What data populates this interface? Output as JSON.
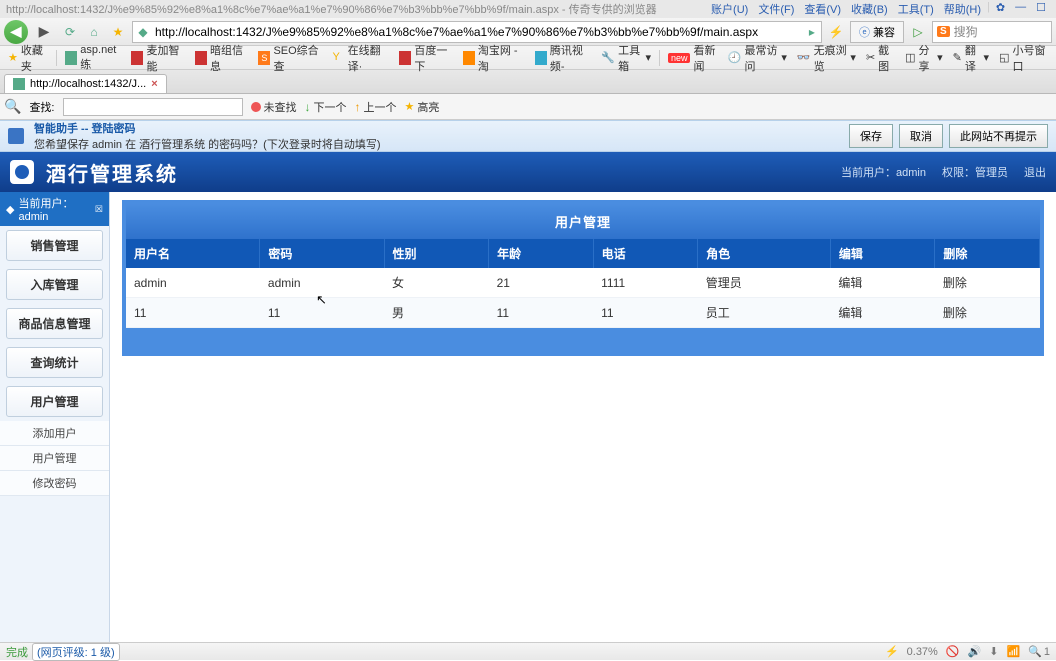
{
  "title_bar": {
    "text": "http://localhost:1432/J%e9%85%92%e8%a1%8c%e7%ae%a1%e7%90%86%e7%b3%bb%e7%bb%9f/main.aspx - 传奇专供的浏览器",
    "menus": [
      "账户(U)",
      "文件(F)",
      "查看(V)",
      "收藏(B)",
      "工具(T)",
      "帮助(H)"
    ]
  },
  "address": {
    "url": "http://localhost:1432/J%e9%85%92%e8%a1%8c%e7%ae%a1%e7%90%86%e7%b3%bb%e7%bb%9f/main.aspx",
    "compat_btn": "兼容",
    "sogou": "搜狗"
  },
  "bookmarks": {
    "fav_label": "收藏夹",
    "items": [
      "asp.net练",
      "麦加智能",
      "暗组信息",
      "SEO综合查",
      "在线翻译·",
      "百度一下",
      "淘宝网 - 淘",
      "腾讯视频-"
    ],
    "right": [
      "工具箱",
      "看新闻",
      "最常访问",
      "无痕浏览",
      "截图",
      "分享",
      "翻译",
      "小号窗口"
    ],
    "new_badge": "new"
  },
  "tab": {
    "label": "http://localhost:1432/J..."
  },
  "find": {
    "label": "查找:",
    "not_found": "未查找",
    "next": "下一个",
    "prev": "上一个",
    "highlight": "高亮"
  },
  "pw_bar": {
    "title": "智能助手 -- 登陆密码",
    "msg": "您希望保存 admin 在 酒行管理系统 的密码吗？(下次登录时将自动填写)",
    "save": "保存",
    "cancel": "取消",
    "never": "此网站不再提示"
  },
  "app": {
    "title": "酒行管理系统",
    "cur_user_lbl": "当前用户：",
    "cur_user": "admin",
    "role_lbl": "权限：",
    "role": "管理员",
    "exit": "退出"
  },
  "sidebar": {
    "user_line": "当前用户：admin",
    "items": [
      "销售管理",
      "入库管理",
      "商品信息管理",
      "查询统计",
      "用户管理"
    ],
    "subs": [
      "添加用户",
      "用户管理",
      "修改密码"
    ]
  },
  "panel": {
    "title": "用户管理",
    "headers": [
      "用户名",
      "密码",
      "性别",
      "年龄",
      "电话",
      "角色",
      "编辑",
      "删除"
    ],
    "rows": [
      {
        "user": "admin",
        "pwd": "admin",
        "sex": "女",
        "age": "21",
        "tel": "1111",
        "role": "管理员",
        "edit": "编辑",
        "del": "删除"
      },
      {
        "user": "11",
        "pwd": "11",
        "sex": "男",
        "age": "11",
        "tel": "11",
        "role": "员工",
        "edit": "编辑",
        "del": "删除"
      }
    ]
  },
  "status": {
    "done": "完成",
    "rating": "(网页评级: 1 级)",
    "speed": "0.37%",
    "zoom": "1"
  }
}
